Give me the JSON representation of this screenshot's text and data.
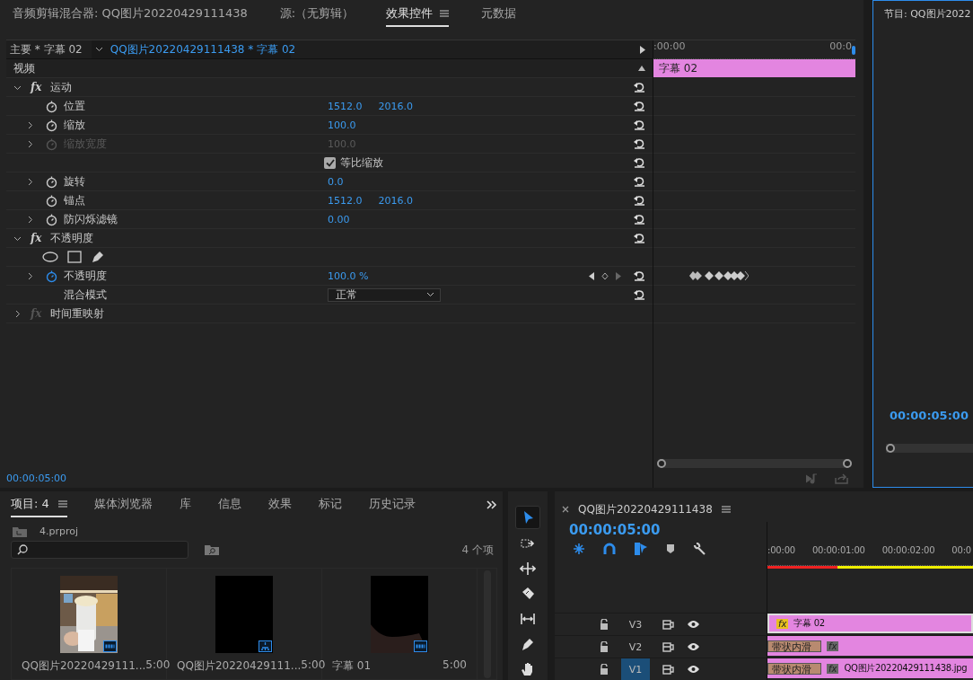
{
  "panel_tabs": [
    {
      "label": "音频剪辑混合器: QQ图片20220429111438",
      "selected": false,
      "menu": false
    },
    {
      "label": "源:（无剪辑）",
      "selected": false,
      "menu": false
    },
    {
      "label": "效果控件",
      "selected": true,
      "menu": true
    },
    {
      "label": "元数据",
      "selected": false,
      "menu": false
    }
  ],
  "clip_tabs": [
    {
      "label": "主要 * 字幕 02",
      "selected": false
    },
    {
      "label": "QQ图片20220429111438 * 字幕 02",
      "selected": true
    }
  ],
  "mini_timeline": {
    "ruler": [
      ":00:00",
      "00:0"
    ],
    "clip": "字幕 02"
  },
  "effect_rows": [
    {
      "kind": "section",
      "label": "视频"
    },
    {
      "kind": "effect",
      "fx": "fx",
      "label": "运动",
      "expanded": true,
      "enabled": true
    },
    {
      "kind": "property",
      "label": "位置",
      "expandable": false,
      "disabled": false,
      "animated": false,
      "values": [
        "1512.0",
        "2016.0"
      ]
    },
    {
      "kind": "property",
      "label": "缩放",
      "expandable": true,
      "disabled": false,
      "animated": false,
      "values": [
        "100.0"
      ]
    },
    {
      "kind": "property",
      "label": "缩放宽度",
      "expandable": true,
      "disabled": true,
      "animated": false,
      "values": [
        "100.0"
      ]
    },
    {
      "kind": "checkbox",
      "label": "等比缩放",
      "checked": true
    },
    {
      "kind": "property",
      "label": "旋转",
      "expandable": true,
      "disabled": false,
      "animated": false,
      "values": [
        "0.0"
      ]
    },
    {
      "kind": "property",
      "label": "锚点",
      "expandable": false,
      "disabled": false,
      "animated": false,
      "values": [
        "1512.0",
        "2016.0"
      ]
    },
    {
      "kind": "property",
      "label": "防闪烁滤镜",
      "expandable": true,
      "disabled": false,
      "animated": false,
      "values": [
        "0.00"
      ]
    },
    {
      "kind": "effect",
      "fx": "fx",
      "label": "不透明度",
      "expanded": true,
      "enabled": true
    },
    {
      "kind": "masks"
    },
    {
      "kind": "property",
      "label": "不透明度",
      "expandable": true,
      "disabled": false,
      "animated": true,
      "values": [
        "100.0 %"
      ]
    },
    {
      "kind": "dropdown",
      "label": "混合模式",
      "value": "正常"
    },
    {
      "kind": "effect",
      "fx": "fx",
      "label": "时间重映射",
      "expanded": false,
      "enabled": false
    }
  ],
  "effect_timecode": "00:00:05:00",
  "program": {
    "title": "节目: QQ图片2022",
    "timecode": "00:00:05:00"
  },
  "project_tabs": [
    {
      "label": "项目: 4",
      "selected": true,
      "menu": true
    },
    {
      "label": "媒体浏览器",
      "selected": false,
      "menu": false
    },
    {
      "label": "库",
      "selected": false,
      "menu": false
    },
    {
      "label": "信息",
      "selected": false,
      "menu": false
    },
    {
      "label": "效果",
      "selected": false,
      "menu": false
    },
    {
      "label": "标记",
      "selected": false,
      "menu": false
    },
    {
      "label": "历史记录",
      "selected": false,
      "menu": false
    }
  ],
  "project_path": "4.prproj",
  "item_count": "4 个项",
  "project_items": [
    {
      "name": "QQ图片20220429111...",
      "duration": "5:00"
    },
    {
      "kind": "sequence",
      "name": "QQ图片20220429111...",
      "duration": "5:00"
    },
    {
      "kind": "title",
      "name": "字幕 01",
      "duration": "5:00"
    }
  ],
  "tools": [
    {
      "kind": "selection",
      "selected": true
    },
    {
      "kind": "track-select",
      "selected": false
    },
    {
      "kind": "ripple",
      "selected": false
    },
    {
      "kind": "razor",
      "selected": false
    },
    {
      "kind": "slip",
      "selected": false
    },
    {
      "kind": "pen",
      "selected": false
    },
    {
      "kind": "hand",
      "selected": false
    }
  ],
  "timeline": {
    "title": "QQ图片20220429111438",
    "timecode": "00:00:05:00",
    "ruler": [
      ":00:00",
      "00:00:01:00",
      "00:00:02:00",
      "00:0"
    ],
    "tracks": [
      {
        "name": "V3",
        "selected": false,
        "fx": "fx",
        "clip": "字幕 02"
      },
      {
        "name": "V2",
        "selected": false,
        "transition": "带状内滑",
        "fx": "fx"
      },
      {
        "name": "V1",
        "selected": true,
        "transition": "带状内滑",
        "fx": "fx",
        "clip": "QQ图片20220429111438.jpg"
      }
    ]
  }
}
